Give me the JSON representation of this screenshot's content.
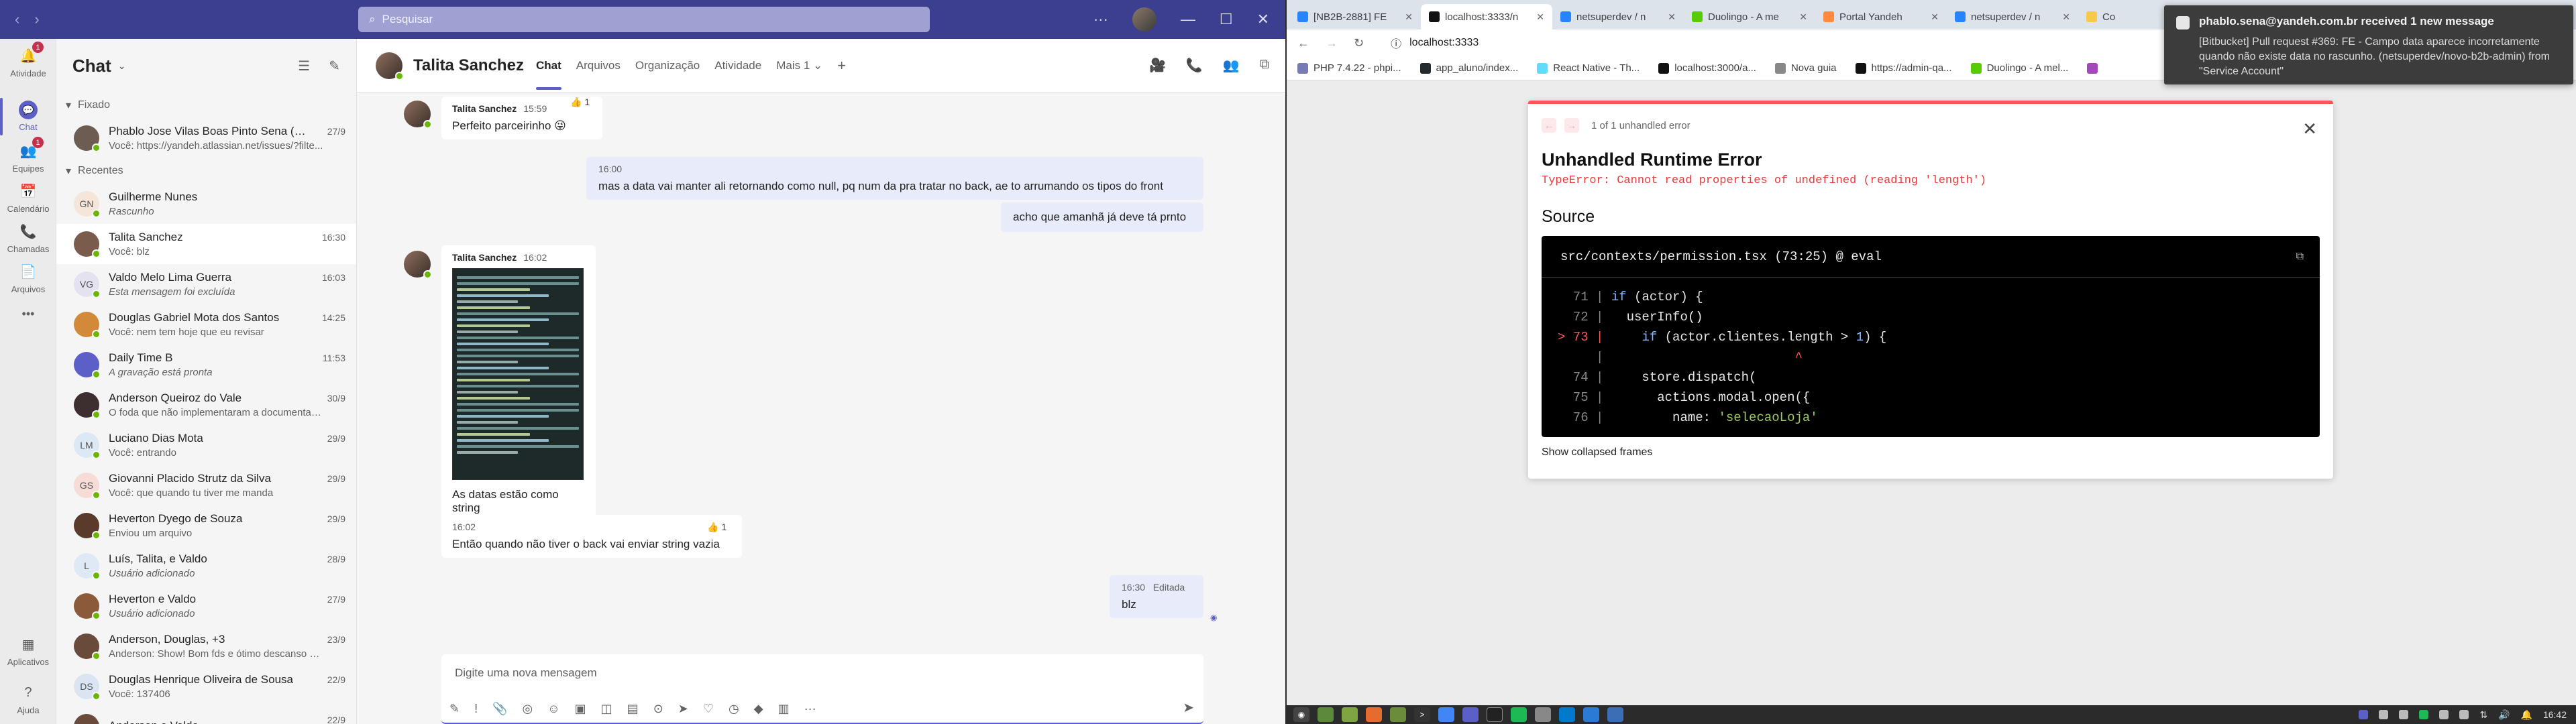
{
  "teams": {
    "search_placeholder": "Pesquisar",
    "rail": [
      {
        "label": "Atividade",
        "icon": "bell-icon",
        "badge": "1"
      },
      {
        "label": "Chat",
        "icon": "chat-icon",
        "badge": ""
      },
      {
        "label": "Equipes",
        "icon": "teams-icon",
        "badge": "1"
      },
      {
        "label": "Calendário",
        "icon": "calendar-icon",
        "badge": ""
      },
      {
        "label": "Chamadas",
        "icon": "phone-icon",
        "badge": ""
      },
      {
        "label": "Arquivos",
        "icon": "file-icon",
        "badge": ""
      },
      {
        "label": "•••",
        "icon": "more-icon",
        "badge": ""
      },
      {
        "label": "Aplicativos",
        "icon": "apps-icon",
        "badge": ""
      },
      {
        "label": "Ajuda",
        "icon": "help-icon",
        "badge": ""
      }
    ],
    "list_title": "Chat",
    "section_pinned": "Fixado",
    "section_recent": "Recentes",
    "pinned": [
      {
        "name": "Phablo Jose Vilas Boas Pinto Sena (V...",
        "preview": "Você: https://yandeh.atlassian.net/issues/?filte...",
        "date": "27/9",
        "initials": "",
        "color": "#6d5c52",
        "italic": false
      }
    ],
    "recent": [
      {
        "name": "Guilherme Nunes",
        "preview": "Rascunho",
        "date": "",
        "initials": "GN",
        "color": "#f6e6d9",
        "italic": true
      },
      {
        "name": "Talita Sanchez",
        "preview": "Você: blz",
        "date": "16:30",
        "initials": "",
        "color": "#7a5c4c",
        "italic": false,
        "active": true
      },
      {
        "name": "Valdo Melo Lima Guerra",
        "preview": "Esta mensagem foi excluída",
        "date": "16:03",
        "initials": "VG",
        "color": "#e4e2f1",
        "italic": true
      },
      {
        "name": "Douglas Gabriel Mota dos Santos",
        "preview": "Você: nem tem hoje que eu revisar",
        "date": "14:25",
        "initials": "",
        "color": "#d28a3a",
        "italic": false
      },
      {
        "name": "Daily Time B",
        "preview": "A gravação está pronta",
        "date": "11:53",
        "initials": "",
        "color": "#5b5fc7",
        "italic": true
      },
      {
        "name": "Anderson Queiroz do Vale",
        "preview": "O foda que não implementaram a documentaç...",
        "date": "30/9",
        "initials": "",
        "color": "#3d2f2f",
        "italic": false
      },
      {
        "name": "Luciano Dias Mota",
        "preview": "Você: entrando",
        "date": "29/9",
        "initials": "LM",
        "color": "#dce8f4",
        "italic": false
      },
      {
        "name": "Giovanni Placido Strutz da Silva",
        "preview": "Você: que quando tu tiver me manda",
        "date": "29/9",
        "initials": "GS",
        "color": "#f7dbd6",
        "italic": false
      },
      {
        "name": "Heverton Dyego de Souza",
        "preview": "Enviou um arquivo",
        "date": "29/9",
        "initials": "",
        "color": "#5a3a2a",
        "italic": false
      },
      {
        "name": "Luís, Talita, e Valdo",
        "preview": "Usuário adicionado",
        "date": "28/9",
        "initials": "L",
        "color": "#dfe9f5",
        "italic": true
      },
      {
        "name": "Heverton e Valdo",
        "preview": "Usuário adicionado",
        "date": "27/9",
        "initials": "",
        "color": "#8a5a3a",
        "italic": true
      },
      {
        "name": "Anderson, Douglas, +3",
        "preview": "Anderson: Show! Bom fds e ótimo descanso pr...",
        "date": "23/9",
        "initials": "",
        "color": "#6a4a3a",
        "italic": false
      },
      {
        "name": "Douglas Henrique Oliveira de Sousa",
        "preview": "Você: 137406",
        "date": "22/9",
        "initials": "DS",
        "color": "#dbe4f3",
        "italic": false
      },
      {
        "name": "Anderson e Valdo",
        "preview": "",
        "date": "22/9",
        "initials": "",
        "color": "#6a4a3a",
        "italic": false
      }
    ],
    "chat": {
      "name": "Talita Sanchez",
      "tabs": [
        "Chat",
        "Arquivos",
        "Organização",
        "Atividade",
        "Mais 1"
      ],
      "messages": {
        "m1": {
          "author": "Talita Sanchez",
          "time": "15:59",
          "text": "Perfeito parceirinho 😜",
          "reaction": "👍 1"
        },
        "m2": {
          "time": "16:00",
          "text": "mas a data vai manter ali retornando como null, pq num da pra tratar no back, ae to arrumando os tipos do front"
        },
        "m3": {
          "text": "acho que amanhã já deve tá prnto"
        },
        "m4": {
          "author": "Talita Sanchez",
          "time": "16:02",
          "text": "As datas estão como string"
        },
        "m5": {
          "time": "16:02",
          "text": "Então quando não tiver o back vai enviar string vazia",
          "reaction": "👍 1"
        },
        "m6": {
          "time": "16:30",
          "edited": "Editada",
          "text": "blz"
        }
      },
      "composer_placeholder": "Digite uma nova mensagem"
    }
  },
  "browser": {
    "tabs": [
      {
        "label": "[NB2B-2881] FE",
        "color": "#2684ff"
      },
      {
        "label": "localhost:3333/n",
        "color": "#111111",
        "active": true
      },
      {
        "label": "netsuperdev / n",
        "color": "#2684ff"
      },
      {
        "label": "Duolingo - A me",
        "color": "#58cc02"
      },
      {
        "label": "Portal Yandeh",
        "color": "#ff8a3d"
      },
      {
        "label": "netsuperdev / n",
        "color": "#2684ff"
      },
      {
        "label": "Co",
        "color": "#f7c948"
      }
    ],
    "url": "localhost:3333",
    "bookmarks": [
      {
        "label": "PHP 7.4.22 - phpi...",
        "color": "#777bb3"
      },
      {
        "label": "app_aluno/index...",
        "color": "#24292e"
      },
      {
        "label": "React Native - Th...",
        "color": "#61dafb"
      },
      {
        "label": "localhost:3000/a...",
        "color": "#111111"
      },
      {
        "label": "Nova guia",
        "color": "#888888"
      },
      {
        "label": "https://admin-qa...",
        "color": "#111111"
      },
      {
        "label": "Duolingo - A mel...",
        "color": "#58cc02"
      },
      {
        "label": "",
        "color": "#a347ba"
      }
    ],
    "error": {
      "counter": "1 of 1 unhandled error",
      "title": "Unhandled Runtime Error",
      "message": "TypeError: Cannot read properties of undefined (reading 'length')",
      "source_label": "Source",
      "file": "src/contexts/permission.tsx (73:25) @ eval",
      "show_collapsed": "Show collapsed frames"
    }
  },
  "notification": {
    "title": "phablo.sena@yandeh.com.br received 1 new message",
    "body": "[Bitbucket] Pull request #369: FE - Campo data aparece incorretamente quando não existe data no rascunho. (netsuperdev/novo-b2b-admin) from \"Service Account\""
  },
  "taskbar": {
    "clock": "16:42"
  }
}
